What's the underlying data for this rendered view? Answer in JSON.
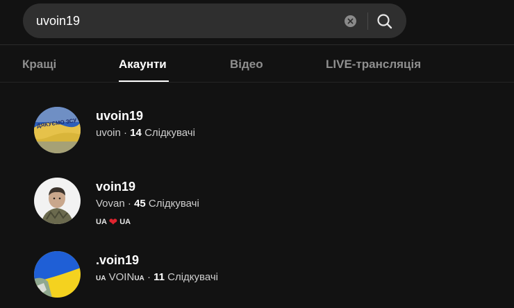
{
  "search": {
    "value": "uvoin19",
    "clear_icon": "clear-circle-icon",
    "search_icon": "magnifier-icon"
  },
  "tabs": [
    {
      "label": "Кращі",
      "active": false
    },
    {
      "label": "Акаунти",
      "active": true
    },
    {
      "label": "Відео",
      "active": false
    },
    {
      "label": "LIVE-трансляція",
      "active": false
    }
  ],
  "accounts": [
    {
      "username": "uvoin19",
      "nickname": "uvoin",
      "separator": "·",
      "followers": "14",
      "followers_label": "Слідкувачі"
    },
    {
      "username": "voin19",
      "nickname": "Vovan",
      "separator": "·",
      "followers": "45",
      "followers_label": "Слідкувачі",
      "bio_left": "UA",
      "bio_heart": "❤",
      "bio_right": "UA"
    },
    {
      "username": ".voin19",
      "nickname_prefix": "UA",
      "nickname": "VOIN",
      "nickname_suffix": "UA",
      "separator": "·",
      "followers": "11",
      "followers_label": "Слідкувачі"
    }
  ],
  "colors": {
    "background": "#121212",
    "search_bg": "#2f2f2f",
    "inactive_tab": "#8f8f8f",
    "heart": "#e0242f",
    "flag_blue": "#1f5fd6",
    "flag_yellow": "#f4d21f"
  },
  "avatar_text": {
    "first": "ДЯКУЄМО ЗСУ"
  }
}
